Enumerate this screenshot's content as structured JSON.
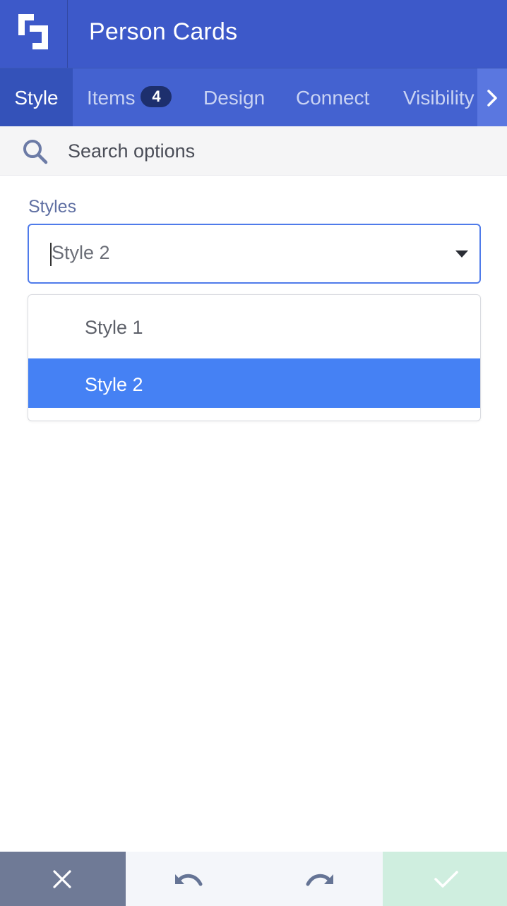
{
  "header": {
    "title": "Person Cards",
    "logo_icon": "builder-logo-icon"
  },
  "tabs": [
    {
      "label": "Style",
      "active": true
    },
    {
      "label": "Items",
      "badge": "4"
    },
    {
      "label": "Design"
    },
    {
      "label": "Connect"
    },
    {
      "label": "Visibility"
    }
  ],
  "tabs_next_icon": "chevron-right-icon",
  "search": {
    "placeholder": "Search options",
    "icon": "search-icon"
  },
  "styles_field": {
    "label": "Styles",
    "value": "Style 2",
    "options": [
      "Style 1",
      "Style 2"
    ],
    "selected_index": 1
  },
  "footer": {
    "cancel_icon": "close-icon",
    "undo_icon": "undo-icon",
    "redo_icon": "redo-icon",
    "confirm_icon": "checkmark-icon"
  },
  "colors": {
    "header_bg": "#3d59c9",
    "tabbar_bg": "#4462d0",
    "active_tab_bg": "#3452b9",
    "selected_option_bg": "#4581f4",
    "focus_border": "#4f7bea",
    "cancel_bg": "#6f7a96",
    "confirm_bg": "#cfeedf"
  }
}
